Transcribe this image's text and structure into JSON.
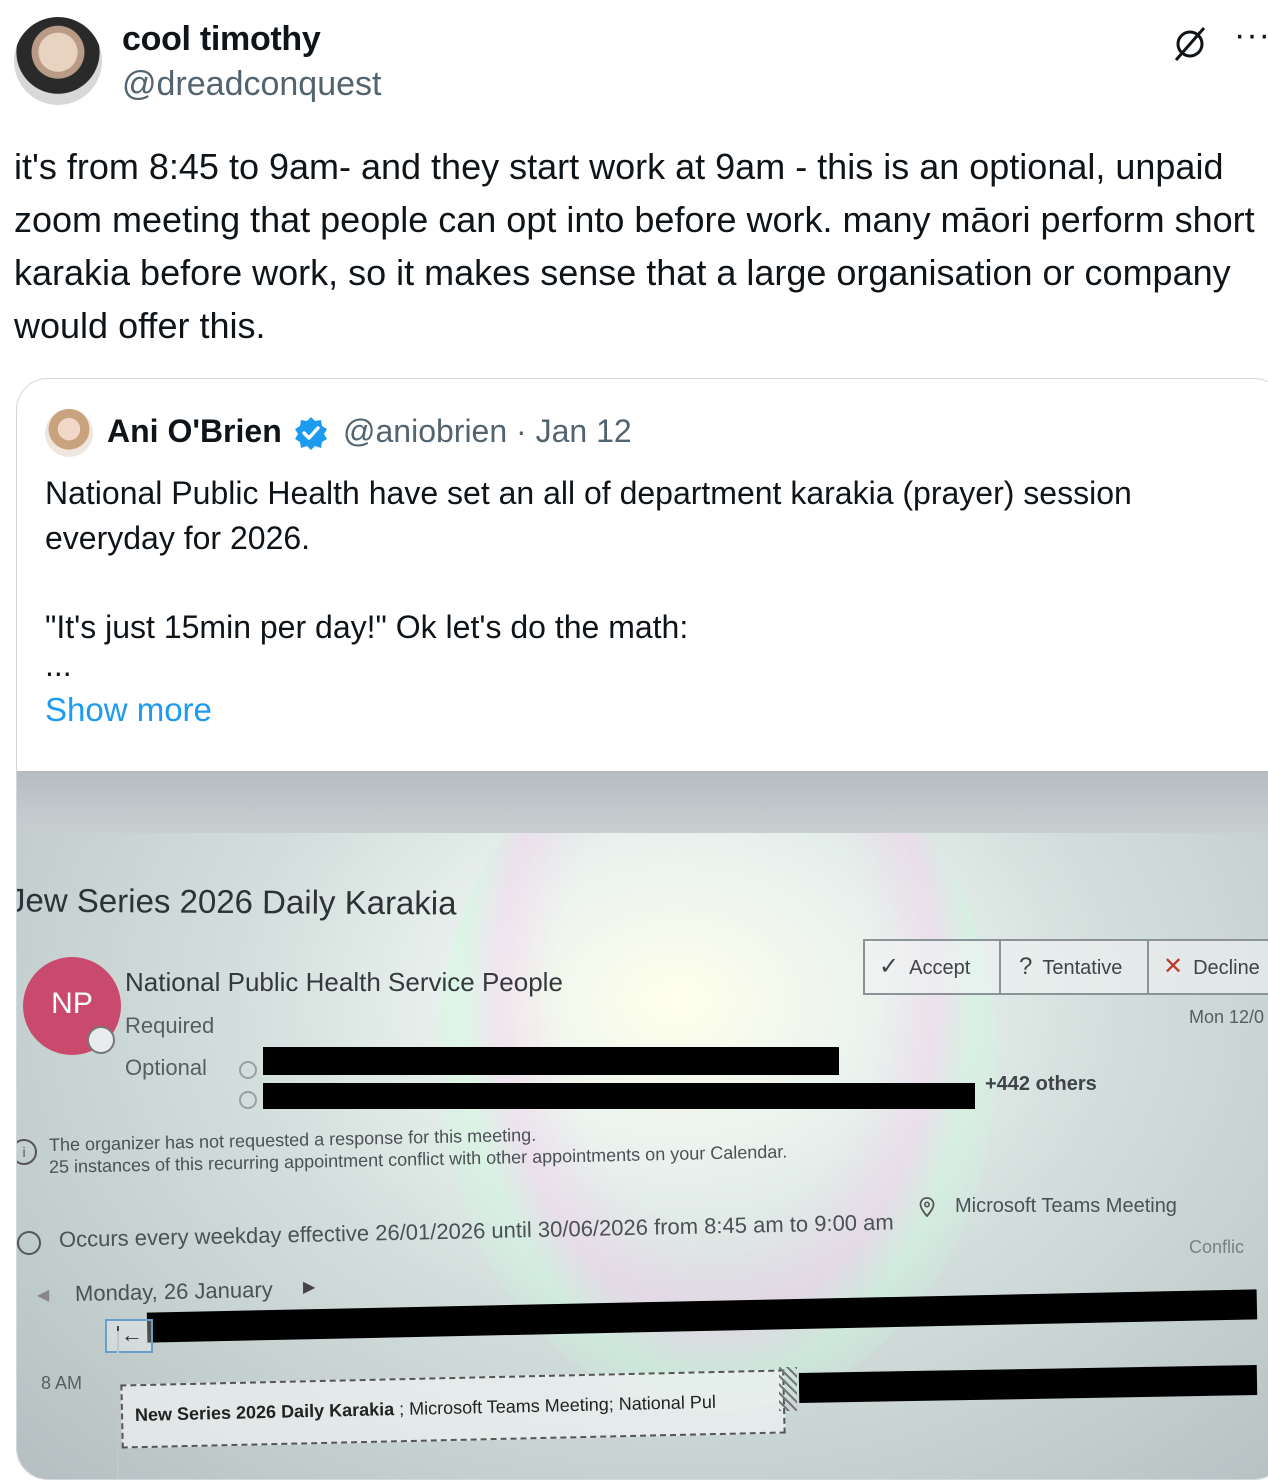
{
  "author": {
    "name": "cool timothy",
    "handle": "@dreadconquest"
  },
  "icons": {
    "grok": "grok-icon",
    "more": "more-icon",
    "verified": "verified-badge-icon",
    "verified_color": "#1d9bf0",
    "link_color": "#1d9bf0"
  },
  "more_glyph": "···",
  "tweet": {
    "text": "it's from 8:45 to 9am- and they start work at 9am - this is an optional, unpaid zoom meeting that people can opt into before work. many māori perform short karakia before work, so it makes sense that a large organisation or company would offer this."
  },
  "quote": {
    "name": "Ani O'Brien",
    "handle_date": "@aniobrien · Jan 12",
    "paragraph1": "National Public Health have set an all of department karakia (prayer) session everyday for 2026.",
    "paragraph2": "\"It's just 15min per day!\" Ok let's do the math:",
    "ellipsis": "...",
    "show_more": "Show more"
  },
  "photo": {
    "title": "Jew Series 2026 Daily Karakia",
    "initials": "NP",
    "organizer": "National Public Health Service People",
    "required_label": "Required",
    "optional_label": "Optional",
    "accept": "Accept",
    "tentative": "Tentative",
    "decline": "Decline",
    "date_short": "Mon 12/0",
    "others": "+442 others",
    "info_line1": "The organizer has not requested a response for this meeting.",
    "info_line2": "25 instances of this recurring appointment conflict with other appointments on your Calendar.",
    "occurs": "Occurs every weekday effective 26/01/2026 until 30/06/2026 from 8:45 am to 9:00 am",
    "location": "Microsoft Teams Meeting",
    "conflict": "Conflic",
    "day": "Monday, 26 January",
    "back_arrow": "|←",
    "hour": "8 AM",
    "event_title": "New Series 2026 Daily Karakia",
    "event_detail": " ; Microsoft Teams Meeting; National Pul"
  }
}
